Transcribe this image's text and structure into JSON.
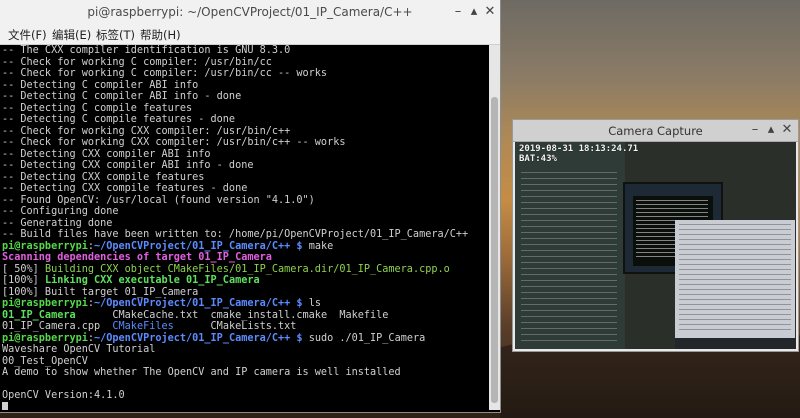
{
  "terminal": {
    "title": "pi@raspberrypi: ~/OpenCVProject/01_IP_Camera/C++",
    "menu": [
      "文件(F)",
      "编辑(E)",
      "标签(T)",
      "帮助(H)"
    ],
    "lines": [
      [
        {
          "t": "-- The CXX compiler identification is GNU 8.3.0"
        }
      ],
      [
        {
          "t": "-- Check for working C compiler: /usr/bin/cc"
        }
      ],
      [
        {
          "t": "-- Check for working C compiler: /usr/bin/cc -- works"
        }
      ],
      [
        {
          "t": "-- Detecting C compiler ABI info"
        }
      ],
      [
        {
          "t": "-- Detecting C compiler ABI info - done"
        }
      ],
      [
        {
          "t": "-- Detecting C compile features"
        }
      ],
      [
        {
          "t": "-- Detecting C compile features - done"
        }
      ],
      [
        {
          "t": "-- Check for working CXX compiler: /usr/bin/c++"
        }
      ],
      [
        {
          "t": "-- Check for working CXX compiler: /usr/bin/c++ -- works"
        }
      ],
      [
        {
          "t": "-- Detecting CXX compiler ABI info"
        }
      ],
      [
        {
          "t": "-- Detecting CXX compiler ABI info - done"
        }
      ],
      [
        {
          "t": "-- Detecting CXX compile features"
        }
      ],
      [
        {
          "t": "-- Detecting CXX compile features - done"
        }
      ],
      [
        {
          "t": "-- Found OpenCV: /usr/local (found version \"4.1.0\")"
        }
      ],
      [
        {
          "t": "-- Configuring done"
        }
      ],
      [
        {
          "t": "-- Generating done"
        }
      ],
      [
        {
          "t": "-- Build files have been written to: /home/pi/OpenCVProject/01_IP_Camera/C++"
        }
      ],
      [
        {
          "t": "pi@raspberrypi",
          "c": "c-green"
        },
        {
          "t": ":",
          "c": ""
        },
        {
          "t": "~/OpenCVProject/01_IP_Camera/C++ $",
          "c": "c-blue"
        },
        {
          "t": " make"
        }
      ],
      [
        {
          "t": "Scanning dependencies of target 01_IP_Camera",
          "c": "c-magenta"
        }
      ],
      [
        {
          "t": "[ 50%] "
        },
        {
          "t": "Building CXX object CMakeFiles/01_IP_Camera.dir/01_IP_Camera.cpp.o",
          "c": "c-yellowgreen"
        }
      ],
      [
        {
          "t": "[100%] "
        },
        {
          "t": "Linking CXX executable 01_IP_Camera",
          "c": "c-brightgreen"
        }
      ],
      [
        {
          "t": "[100%] Built target 01_IP_Camera"
        }
      ],
      [
        {
          "t": "pi@raspberrypi",
          "c": "c-green"
        },
        {
          "t": ":",
          "c": ""
        },
        {
          "t": "~/OpenCVProject/01_IP_Camera/C++ $",
          "c": "c-blue"
        },
        {
          "t": " ls"
        }
      ],
      [
        {
          "t": "01_IP_Camera",
          "c": "c-brightgreen"
        },
        {
          "t": "      CMakeCache.txt  cmake_install.cmake  Makefile"
        }
      ],
      [
        {
          "t": "01_IP_Camera.cpp  "
        },
        {
          "t": "CMakeFiles",
          "c": "c-dirblue"
        },
        {
          "t": "      CMakeLists.txt"
        }
      ],
      [
        {
          "t": "pi@raspberrypi",
          "c": "c-green"
        },
        {
          "t": ":",
          "c": ""
        },
        {
          "t": "~/OpenCVProject/01_IP_Camera/C++ $",
          "c": "c-blue"
        },
        {
          "t": " sudo ./01_IP_Camera"
        }
      ],
      [
        {
          "t": "Waveshare OpenCV Tutorial"
        }
      ],
      [
        {
          "t": "00_Test_OpenCV"
        }
      ],
      [
        {
          "t": "A demo to show whether The OpenCV and IP camera is well installed"
        }
      ],
      [
        {
          "t": ""
        }
      ],
      [
        {
          "t": "OpenCV Version:4.1.0"
        }
      ]
    ]
  },
  "camera": {
    "title": "Camera Capture",
    "timestamp": "2019-08-31 18:13:24.71",
    "battery": "BAT:43%"
  },
  "icons": {
    "minimize": "minimize-icon",
    "maximize": "maximize-icon",
    "close": "close-icon"
  }
}
